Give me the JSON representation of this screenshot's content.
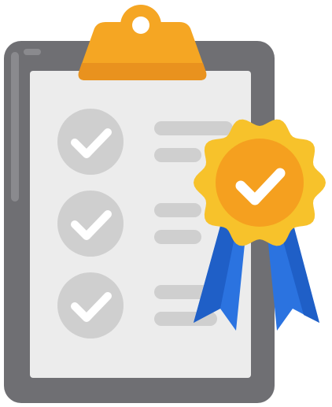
{
  "illustration": {
    "icon": "clipboard-checklist-award-icon",
    "checklist": {
      "items": [
        {
          "icon": "check-circle-icon",
          "checked": true
        },
        {
          "icon": "check-circle-icon",
          "checked": true
        },
        {
          "icon": "check-circle-icon",
          "checked": true
        }
      ]
    },
    "badge": {
      "icon": "award-ribbon-icon",
      "checked": true
    },
    "colors": {
      "board": "#6f6f73",
      "board_highlight": "#8a8a8e",
      "paper": "#ececec",
      "paper_light": "#f4f4f4",
      "clip": "#f5a623",
      "clip_dark": "#e9921e",
      "check_gray": "#cfcfcf",
      "rosette_yellow": "#f7c22b",
      "rosette_orange": "#f5a01f",
      "ribbon_blue": "#2b73e0",
      "ribbon_blue_dark": "#1f5fc7",
      "check_white": "#ffffff"
    }
  }
}
